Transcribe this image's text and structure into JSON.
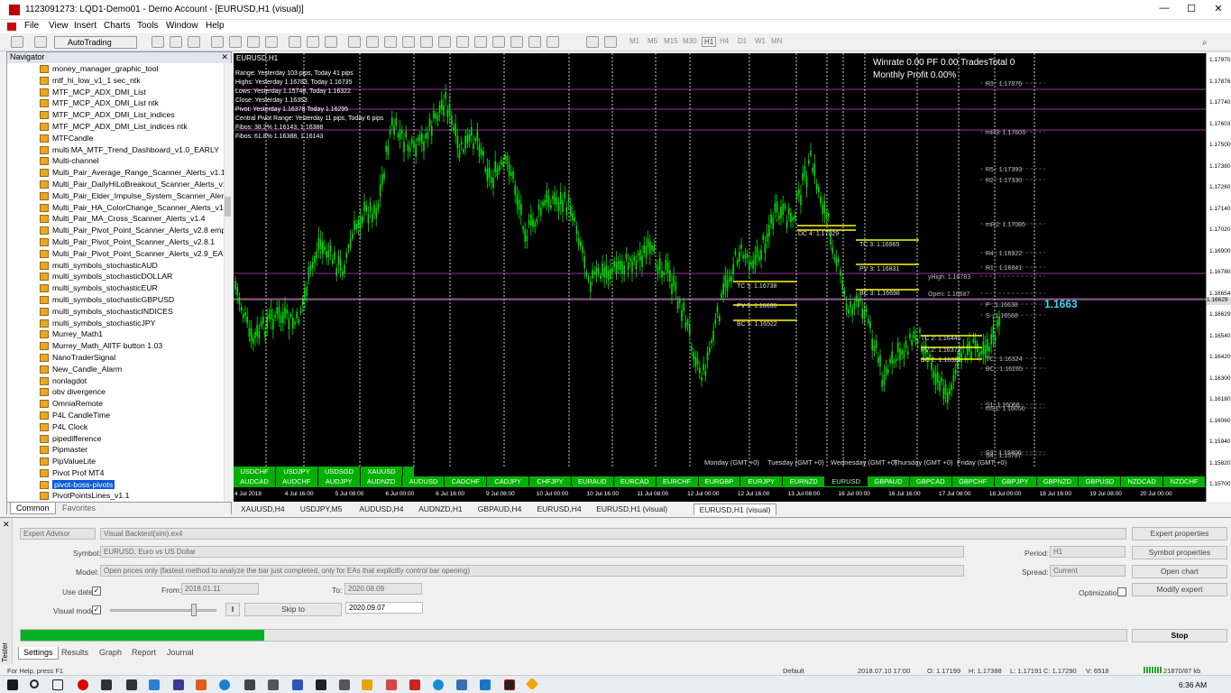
{
  "window": {
    "title": "1123091273: LQD1-Demo01 - Demo Account - [EURUSD,H1 (visual)]",
    "min": "—",
    "max": "☐",
    "close": "✕"
  },
  "menu": [
    "File",
    "View",
    "Insert",
    "Charts",
    "Tools",
    "Window",
    "Help"
  ],
  "toolbar": {
    "autotrading": "AutoTrading",
    "timeframes": [
      "M1",
      "M5",
      "M15",
      "M30",
      "H1",
      "H4",
      "D1",
      "W1",
      "MN"
    ]
  },
  "navigator": {
    "title": "Navigator",
    "items": [
      "money_manager_graphic_tool",
      "mtf_hi_low_v1_1 sec_ntk",
      "MTF_MCP_ADX_DMI_List",
      "MTF_MCP_ADX_DMI_List ntk",
      "MTF_MCP_ADX_DMI_List_indices",
      "MTF_MCP_ADX_DMI_List_indices ntk",
      "MTFCandle",
      "multi  MA_MTF_Trend_Dashboard_v1.0_EARLY",
      "Multi-channel",
      "Multi_Pair_Average_Range_Scanner_Alerts_v1.1",
      "Multi_Pair_DailyHiLoBreakout_Scanner_Alerts_v1.",
      "Multi_Pair_Elder_Impulse_System_Scanner_Alerts_",
      "Multi_Pair_HA_ColorChange_Scanner_Alerts_v1.0",
      "Multi_Pair_MA_Cross_Scanner_Alerts_v1.4",
      "Multi_Pair_Pivot_Point_Scanner_Alerts_v2.8 empty",
      "Multi_Pair_Pivot_Point_Scanner_Alerts_v2.8.1",
      "Multi_Pair_Pivot_Point_Scanner_Alerts_v2.9_EARL",
      "multi_symbols_stochasticAUD",
      "multi_symbols_stochasticDOLLAR",
      "multi_symbols_stochasticEUR",
      "multi_symbols_stochasticGBPUSD",
      "multi_symbols_stochasticINDICES",
      "multi_symbols_stochasticJPY",
      "Murrey_Math1",
      "Murrey_Math_AllTF button 1.03",
      "NanoTraderSignal",
      "New_Candle_Alarm",
      "nonlagdot",
      "obv divergence",
      "OmniaRemote",
      "P4L CandleTime",
      "P4L Clock",
      "pipedifference",
      "Pipmaster",
      "PipValueLite",
      "Pivot Prof MT4",
      "pivot-boss-pivots",
      "PivotPointsLines_v1.1"
    ],
    "selected_index": 36,
    "tabs": [
      "Common",
      "Favorites"
    ]
  },
  "chart": {
    "symbol_label": "EURUSD,H1",
    "stats": [
      "Range: Yesterday 103 pips, Today 41 pips",
      "Highs: Yesterday 1.16783, Today 1.16735",
      "Lows: Yesterday 1.15748, Today 1.16322",
      "Close: Yesterday 1.16353",
      "Pivot: Yesterday 1.16378 Today 1.16295",
      "Central Pivot Range: Yesterday 11 pips, Today 6 pips",
      "Fibos: 38.2% 1.16143, 1.16388",
      "Fibos: 61.8% 1.16388, 1.16143"
    ],
    "winrate_line": "Winrate  0.00  PF  0.00   TradesTotal 0",
    "monthly_profit": "Monthly Profit  0.00%",
    "bid_big": "1.1663",
    "pivot_labels": [
      "R3 : 1.17876",
      "mR3: 1.17603",
      "R5 : 1.17393",
      "R2 : 1.17330",
      "mR2: 1.17085",
      "R4 : 1.16922",
      "R1 : 1.16841",
      "yHigh: 1.16783",
      "Open: 1.16687",
      "P : 1.16638",
      "S : 1.16568",
      "TC : 1.16324",
      "BC : 1.16265",
      "S1: 1.16068",
      "mS1: 1.16050",
      "S3 : 1.15806",
      "S4 : 1.15787"
    ],
    "cpr_labels": [
      "TC 3: 1.16965",
      "PV 3: 1.16831",
      "BC 3: 1.16698",
      "TC 5: 1.16738",
      "PV 5: 1.16630",
      "BC 5: 1.16522",
      "DC 4: 1.17029",
      "TC 2: 1.16445",
      "PV 2: 1.16372",
      "BC 2: 1.16321"
    ],
    "day_labels": [
      "Monday  (GMT +0)",
      "Tuesday  (GMT +0)",
      "Wednesday  (GMT +0)",
      "Thursday  (GMT +0)",
      "Friday  (GMT +0)"
    ],
    "price_scale": [
      "1.17970",
      "1.17876",
      "1.17740",
      "1.17603",
      "1.17500",
      "1.17380",
      "1.17260",
      "1.17140",
      "1.17020",
      "1.16900",
      "1.16780",
      "1.16654",
      "1.16629",
      "1.16540",
      "1.16420",
      "1.16300",
      "1.16180",
      "1.16060",
      "1.15940",
      "1.15820",
      "1.15700"
    ],
    "current_price_tag": "1.16629",
    "x_labels": [
      "4 Jul 2018",
      "4 Jul 16:00",
      "5 Jul 08:00",
      "6 Jul 00:00",
      "6 Jul 16:00",
      "9 Jul 08:00",
      "10 Jul 00:00",
      "10 Jul 16:00",
      "11 Jul 08:00",
      "12 Jul 00:00",
      "12 Jul 16:00",
      "13 Jul 08:00",
      "16 Jul 00:00",
      "16 Jul 16:00",
      "17 Jul 08:00",
      "18 Jul 00:00",
      "18 Jul 16:00",
      "19 Jul 08:00",
      "20 Jul 00:00"
    ],
    "symbols_row1": [
      "USDCHF",
      "USDJPY",
      "USDSGD",
      "XAUUSD"
    ],
    "symbols_row2": [
      "AUDCAD",
      "AUDCHF",
      "AUDJPY",
      "AUDNZD",
      "AUDUSD",
      "CADCHF",
      "CADJPY",
      "CHFJPY",
      "EURAUD",
      "EURCAD",
      "EURCHF",
      "EURGBP",
      "EURJPY",
      "EURNZD",
      "EURUSD",
      "GBPAUD",
      "GBPCAD",
      "GBPCHF",
      "GBPJPY",
      "GBPNZD",
      "GBPUSD",
      "NZDCAD",
      "NZDCHF"
    ],
    "active_symbol": "EURUSD"
  },
  "chart_tabs": [
    "XAUUSD,H4",
    "USDJPY,M5",
    "AUDUSD,H4",
    "AUDNZD,H1",
    "GBPAUD,H4",
    "EURUSD,H4",
    "EURUSD,H1 (visual)",
    "EURUSD,H1 (visual)"
  ],
  "tester": {
    "type": "Expert Advisor",
    "ea": "Visual Backtest(sim).ex4",
    "symbol_label": "Symbol:",
    "symbol": "EURUSD, Euro vs US Dollar",
    "model_label": "Model:",
    "model": "Open prices only (fastest method to analyze the bar just completed, only for EAs that explicitly control bar opening)",
    "use_date_label": "Use date",
    "from_label": "From:",
    "from": "2018.01.11",
    "to_label": "To:",
    "to": "2020.08.09",
    "visual_mode_label": "Visual mode",
    "skip_to": "Skip to",
    "skip_date": "2020.09.07",
    "period_label": "Period:",
    "period": "H1",
    "spread_label": "Spread:",
    "spread": "Current",
    "optimization_label": "Optimization",
    "buttons": {
      "expert_properties": "Expert properties",
      "symbol_properties": "Symbol properties",
      "open_chart": "Open chart",
      "modify_expert": "Modify expert",
      "stop": "Stop"
    },
    "progress": 0.22,
    "tabs": [
      "Settings",
      "Results",
      "Graph",
      "Report",
      "Journal"
    ],
    "side_label": "Tester"
  },
  "status": {
    "help": "For Help, press F1",
    "profile": "Default",
    "time": "2018.07.10 17:00",
    "open": "O: 1.17199",
    "high": "H: 1.17388",
    "low": "L: 1.17191",
    "close": "C: 1.17290",
    "volume": "V: 6518",
    "traffic": "21870/87 kb"
  },
  "taskbar": {
    "clock": "6:36 AM"
  },
  "colors": {
    "candle": "#00e000",
    "chart_bg": "#000000",
    "pivot_line": "#9b2e9b",
    "cpr": "#ffff00",
    "symbol_btn": "#00b000",
    "progress": "#06b025"
  }
}
